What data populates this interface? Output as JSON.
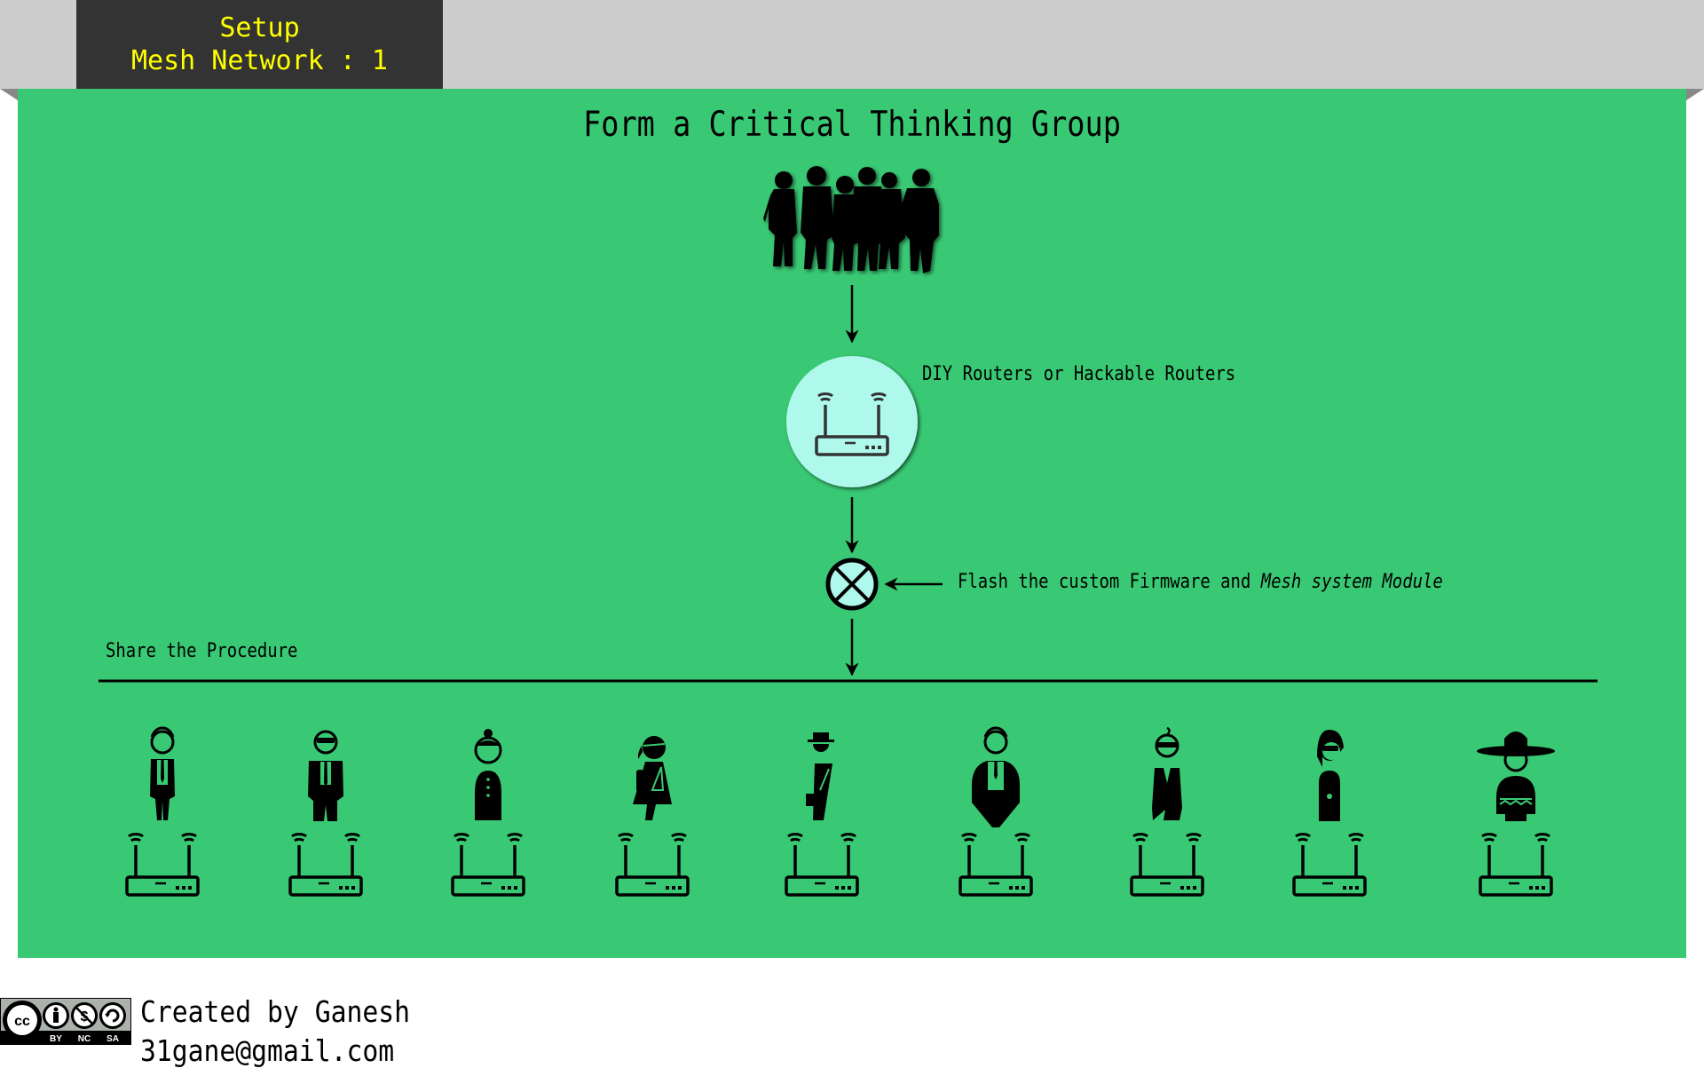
{
  "header": {
    "line1": "Setup",
    "line2": "Mesh Network : 1"
  },
  "diagram": {
    "title": "Form a Critical Thinking Group",
    "nodes": [
      {
        "id": "group",
        "icon": "group-silhouette-icon"
      },
      {
        "id": "router",
        "icon": "router-icon",
        "label": "DIY Routers or Hackable Routers"
      },
      {
        "id": "flash",
        "icon": "cross-circle-icon",
        "label_prefix": "Flash the custom Firmware and ",
        "label_emphasis": "Mesh system Module"
      }
    ],
    "share_label": "Share the Procedure",
    "members": [
      {
        "person": "man-tie",
        "device": "router"
      },
      {
        "person": "man-sunglasses-suit",
        "device": "router"
      },
      {
        "person": "woman-bun-coat",
        "device": "router"
      },
      {
        "person": "girl-backpack",
        "device": "router"
      },
      {
        "person": "man-hat-briefcase",
        "device": "router"
      },
      {
        "person": "man-big-suit",
        "device": "router"
      },
      {
        "person": "man-sunglasses-jacket",
        "device": "router"
      },
      {
        "person": "woman-sunglasses-dress",
        "device": "router"
      },
      {
        "person": "man-sombrero-poncho",
        "device": "router"
      }
    ],
    "colors": {
      "panel": "#39c974",
      "header_bg": "#cdcdcd",
      "title_box": "#333333",
      "title_text": "#ffff00",
      "router_circle": "#aef8ec"
    }
  },
  "footer": {
    "license": {
      "badge": "cc-by-nc-sa-icon",
      "labels": [
        "BY",
        "NC",
        "SA"
      ]
    },
    "created_by": "Created by Ganesh",
    "email": "31gane@gmail.com"
  }
}
